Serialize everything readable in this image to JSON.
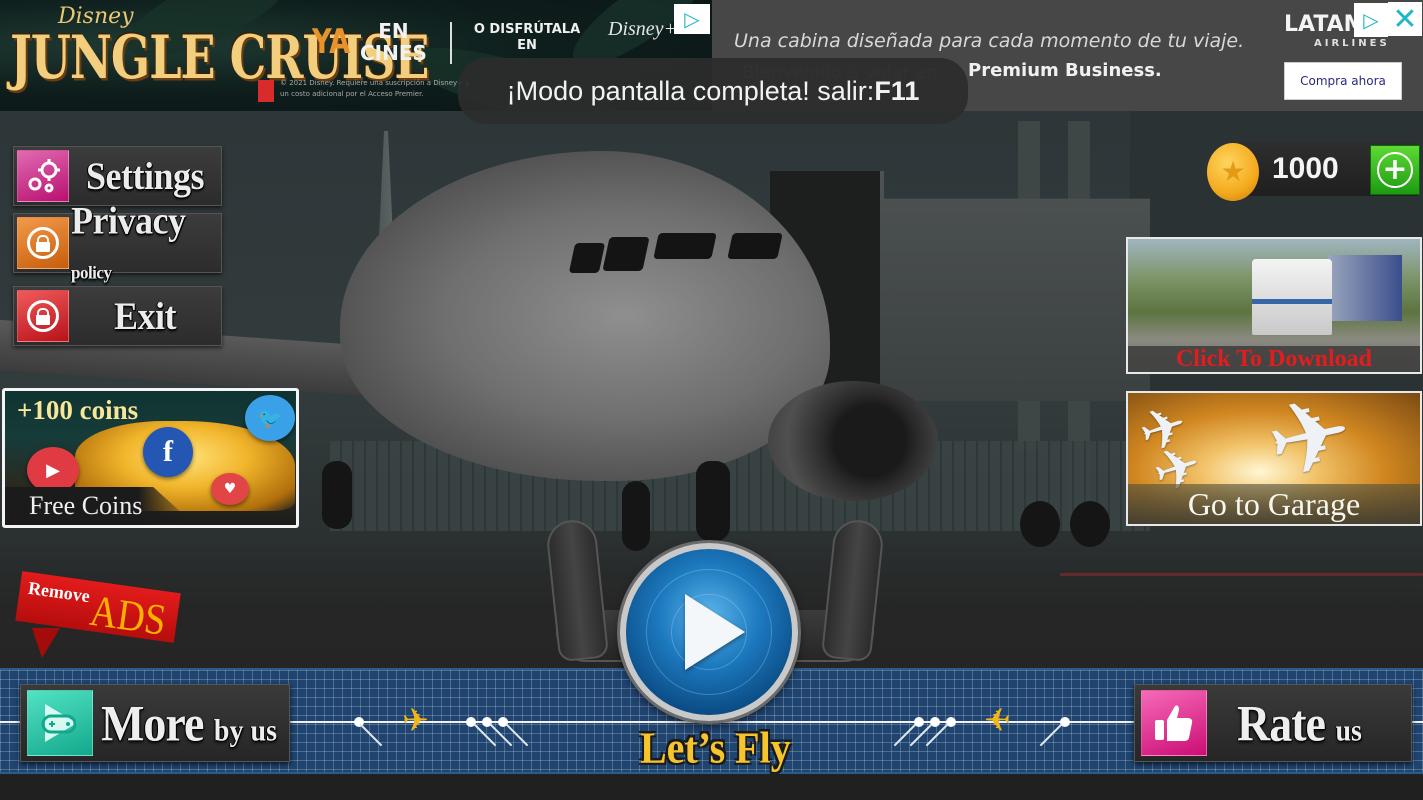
{
  "ads": {
    "left": {
      "brand_small": "Disney",
      "title": "JUNGLE CRUISE",
      "ya": "YA",
      "en_cines_line1": "EN",
      "en_cines_line2": "CINES",
      "disfruta_line1": "O DISFRÚTALA",
      "disfruta_line2": "EN",
      "platform": "Disney+",
      "legal": "© 2021 Disney. Requiere una suscripción a Disney+ y un costo adicional por el Acceso Premier.",
      "adchoice_icon": "▷"
    },
    "right": {
      "tagline": "Una cabina diseñada para cada momento de tu viaje.",
      "tagline2": "Bienvenido a volar en",
      "highlight": "Premium Business.",
      "brand": "LATAM",
      "brand_sub": "AIRLINES",
      "cta": "Compra ahora",
      "adchoice_icon": "▷",
      "close_icon": "✕"
    }
  },
  "toast": {
    "text": "¡Modo pantalla completa! salir:",
    "key": "F11"
  },
  "menu": {
    "items": [
      {
        "id": "settings",
        "label": "Settings",
        "small": "",
        "icon": "gear-icon",
        "color": "#d0258a"
      },
      {
        "id": "privacy",
        "label": "Privacy",
        "small": "policy",
        "icon": "lock-icon",
        "color": "#e27217"
      },
      {
        "id": "exit",
        "label": "Exit",
        "small": "",
        "icon": "lock-icon",
        "color": "#d81f26"
      }
    ]
  },
  "free_coins": {
    "title": "+100 coins",
    "label": "Free Coins"
  },
  "remove_ads": {
    "line1": "Remove",
    "line2": "ADS"
  },
  "wallet": {
    "coins": "1000",
    "add_icon": "+"
  },
  "promos": {
    "download": {
      "label": "Click To Download"
    },
    "garage": {
      "label": "Go to Garage"
    }
  },
  "bottom": {
    "more": {
      "label": "More",
      "small": "by us"
    },
    "play": {
      "label": "Let’s Fly"
    },
    "rate": {
      "label": "Rate",
      "small": "us"
    }
  },
  "colors": {
    "settings_icon": "#d0258a",
    "privacy_icon": "#e27217",
    "exit_icon": "#d81f26",
    "more_icon": "#26c4a8",
    "rate_icon": "#e6198a",
    "lets_fly": "#f6c52e",
    "download_text": "#e21d1d",
    "blueprint": "#1f4470"
  }
}
